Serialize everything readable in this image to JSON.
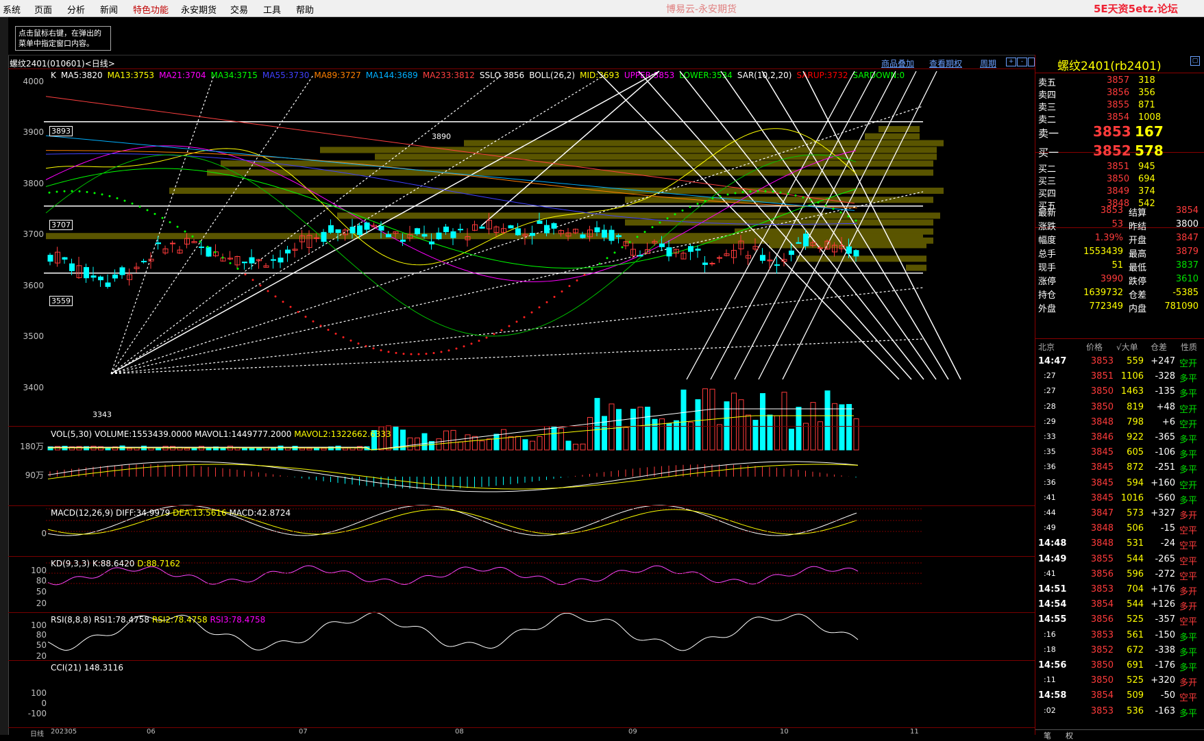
{
  "menu": [
    "系统",
    "页面",
    "分析",
    "新闻",
    "特色功能",
    "永安期货",
    "交易",
    "工具",
    "帮助"
  ],
  "app_title": "博易云-永安期货",
  "brand": "5E天资5etz.论坛",
  "tip": "点击鼠标右键，在弹出的菜单中指定窗口内容。",
  "chart_tab": "螺纹2401(010601)<日线>",
  "toolbar_links": [
    "商品叠加",
    "查看期权",
    "周期"
  ],
  "ma_line": [
    {
      "t": "K",
      "c": "#ffffff"
    },
    {
      "t": "MA5:3820",
      "c": "#ffffff"
    },
    {
      "t": "MA13:3753",
      "c": "#ffff00"
    },
    {
      "t": "MA21:3704",
      "c": "#ff00ff"
    },
    {
      "t": "MA34:3715",
      "c": "#00ff00"
    },
    {
      "t": "MA55:3730",
      "c": "#4040ff"
    },
    {
      "t": "MA89:3727",
      "c": "#ff8000"
    },
    {
      "t": "MA144:3689",
      "c": "#00b0ff"
    },
    {
      "t": "MA233:3812",
      "c": "#ff4040"
    },
    {
      "t": "SSLO 3856",
      "c": "#ffffff"
    },
    {
      "t": "BOLL(26,2)",
      "c": "#ffffff"
    },
    {
      "t": "MID:3693",
      "c": "#ffff00"
    },
    {
      "t": "UPPER:3853",
      "c": "#ff00ff"
    },
    {
      "t": "LOWER:3534",
      "c": "#00ff00"
    },
    {
      "t": "SAR(10,2,20)",
      "c": "#ffffff"
    },
    {
      "t": "SARUP:3732",
      "c": "#ff0000"
    },
    {
      "t": "SARDOWN:0",
      "c": "#00ff00"
    }
  ],
  "price_axis": [
    "4000",
    "3900",
    "3800",
    "3700",
    "3600",
    "3500",
    "3400"
  ],
  "price_marks": {
    "hi": "3893",
    "mid": "3707",
    "lo": "3559",
    "peak": "3890",
    "low": "3343"
  },
  "vol": {
    "label": "VOL(5,30)",
    "v1": "VOLUME:1553439.0000",
    "v2": "MAVOL1:1449777.2000",
    "v3": "MAVOL2:1322662.6333",
    "ax1": "180万",
    "ax2": "90万"
  },
  "macd": {
    "label": "MACD(12,26,9)",
    "v1": "DIFF:34.9979",
    "v2": "DEA:13.5616",
    "v3": "MACD:42.8724",
    "ax": "0"
  },
  "kd": {
    "label": "KD(9,3,3)",
    "v1": "K:88.6420",
    "v2": "D:88.7162",
    "ax": [
      "100",
      "80",
      "50",
      "20"
    ]
  },
  "rsi": {
    "label": "RSI(8,8,8)",
    "v1": "RSI1:78.4758",
    "v2": "RSI2:78.4758",
    "v3": "RSI3:78.4758",
    "ax": [
      "100",
      "80",
      "50",
      "20"
    ]
  },
  "cci": {
    "label": "CCI(21)",
    "v1": "148.3116",
    "ax": [
      "100",
      "0",
      "-100"
    ]
  },
  "x_axis": {
    "label": "日线",
    "items": [
      "202305",
      "06",
      "07",
      "08",
      "09",
      "10",
      "11"
    ]
  },
  "quote": {
    "title": "螺纹2401(rb2401)",
    "asks": [
      [
        "卖五",
        "3857",
        "318"
      ],
      [
        "卖四",
        "3856",
        "356"
      ],
      [
        "卖三",
        "3855",
        "871"
      ],
      [
        "卖二",
        "3854",
        "1008"
      ],
      [
        "卖一",
        "3853",
        "167"
      ]
    ],
    "bids": [
      [
        "买一",
        "3852",
        "578"
      ],
      [
        "买二",
        "3851",
        "945"
      ],
      [
        "买三",
        "3850",
        "694"
      ],
      [
        "买四",
        "3849",
        "374"
      ],
      [
        "买五",
        "3848",
        "542"
      ]
    ],
    "stats": [
      [
        "最新",
        "3853",
        "结算",
        "3854"
      ],
      [
        "涨跌",
        "53",
        "昨结",
        "3800"
      ],
      [
        "幅度",
        "1.39%",
        "开盘",
        "3847"
      ],
      [
        "总手",
        "1553439",
        "最高",
        "3879"
      ],
      [
        "现手",
        "51",
        "最低",
        "3837"
      ],
      [
        "涨停",
        "3990",
        "跌停",
        "3610"
      ],
      [
        "持仓",
        "1639732",
        "仓差",
        "-5385"
      ],
      [
        "外盘",
        "772349",
        "内盘",
        "781090"
      ]
    ],
    "tick_hdr": [
      "北京",
      "价格",
      "√大单",
      "仓差",
      "性质"
    ],
    "ticks": [
      [
        "14:47",
        "3853",
        "559",
        "+247",
        "空开"
      ],
      [
        ":27",
        "3851",
        "1106",
        "-328",
        "多平"
      ],
      [
        ":27",
        "3850",
        "1463",
        "-135",
        "多平"
      ],
      [
        ":28",
        "3850",
        "819",
        "+48",
        "空开"
      ],
      [
        ":29",
        "3848",
        "798",
        "+6",
        "空开"
      ],
      [
        ":33",
        "3846",
        "922",
        "-365",
        "多平"
      ],
      [
        ":35",
        "3845",
        "605",
        "-106",
        "多平"
      ],
      [
        ":36",
        "3845",
        "872",
        "-251",
        "多平"
      ],
      [
        ":36",
        "3845",
        "594",
        "+160",
        "空开"
      ],
      [
        ":41",
        "3845",
        "1016",
        "-560",
        "多平"
      ],
      [
        ":44",
        "3847",
        "573",
        "+327",
        "多开"
      ],
      [
        ":49",
        "3848",
        "506",
        "-15",
        "空平"
      ],
      [
        "14:48",
        "3848",
        "531",
        "-24",
        "空平"
      ],
      [
        "14:49",
        "3855",
        "544",
        "-265",
        "空平"
      ],
      [
        ":41",
        "3856",
        "596",
        "-272",
        "空平"
      ],
      [
        "14:51",
        "3853",
        "704",
        "+176",
        "多开"
      ],
      [
        "14:54",
        "3854",
        "544",
        "+126",
        "多开"
      ],
      [
        "14:55",
        "3856",
        "525",
        "-357",
        "空平"
      ],
      [
        ":16",
        "3853",
        "561",
        "-150",
        "多平"
      ],
      [
        ":18",
        "3852",
        "672",
        "-338",
        "多平"
      ],
      [
        "14:56",
        "3850",
        "691",
        "-176",
        "多平"
      ],
      [
        ":11",
        "3850",
        "525",
        "+320",
        "多开"
      ],
      [
        "14:58",
        "3854",
        "509",
        "-50",
        "空平"
      ],
      [
        ":02",
        "3853",
        "536",
        "-163",
        "多平"
      ]
    ],
    "bottom_tabs": [
      "笔",
      "权"
    ]
  },
  "colors": {
    "up": "#ff3b3b",
    "down": "#00ffff",
    "panel_border": "#7a0000"
  }
}
